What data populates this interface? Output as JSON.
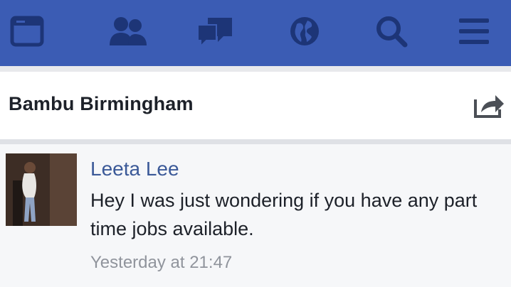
{
  "nav": {
    "items": [
      {
        "icon": "news-feed-icon"
      },
      {
        "icon": "friend-requests-icon"
      },
      {
        "icon": "messages-icon"
      },
      {
        "icon": "notifications-globe-icon"
      },
      {
        "icon": "search-icon"
      },
      {
        "icon": "menu-icon"
      }
    ],
    "bar_color": "#3b5cb4",
    "icon_color": "#1d3577"
  },
  "header": {
    "title": "Bambu Birmingham",
    "share_icon": "share-icon"
  },
  "message": {
    "sender": "Leeta Lee",
    "text": "Hey I was just wondering if you have any part time jobs available.",
    "time": "Yesterday at 21:47",
    "avatar_icon": "avatar"
  }
}
